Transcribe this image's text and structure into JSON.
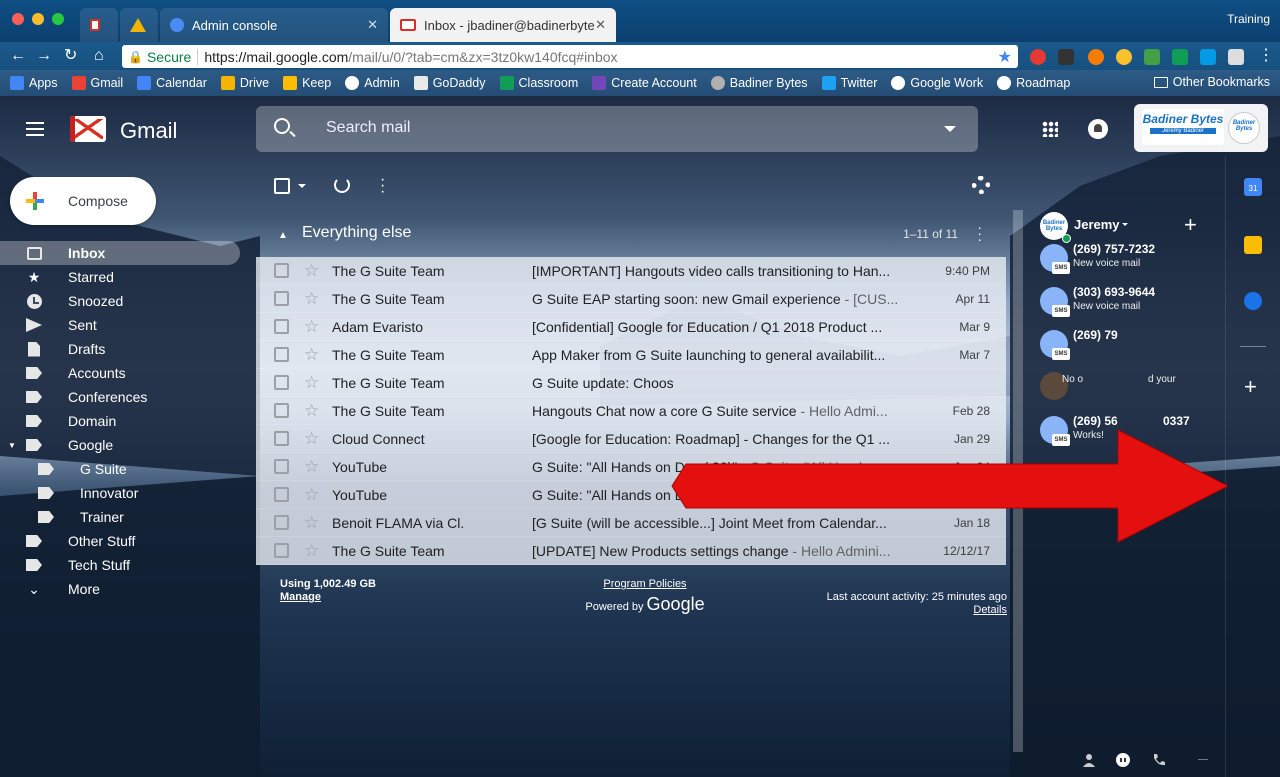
{
  "browser": {
    "tabs": [
      {
        "title": "",
        "icon": "gmail-favicon",
        "active": false
      },
      {
        "title": "",
        "icon": "drive-favicon",
        "active": false
      },
      {
        "title": "Admin console",
        "icon": "admin-favicon",
        "active": false
      },
      {
        "title": "Inbox - jbadiner@badinerbytes",
        "icon": "gmail-favicon",
        "active": true
      }
    ],
    "profile_label": "Training",
    "omnibox": {
      "secure_label": "Secure",
      "url_host": "https://mail.google.com",
      "url_path": "/mail/u/0/?tab=cm&zx=3tz0kw140fcq#inbox"
    },
    "bookmarks": [
      {
        "label": "Apps",
        "icon": "apps-grid-icon",
        "color": "#4285f4"
      },
      {
        "label": "Gmail",
        "icon": "gmail-icon",
        "color": "#ea4335"
      },
      {
        "label": "Calendar",
        "icon": "calendar-icon",
        "color": "#4285f4"
      },
      {
        "label": "Drive",
        "icon": "drive-icon",
        "color": "#f4b400"
      },
      {
        "label": "Keep",
        "icon": "keep-icon",
        "color": "#fbbc04"
      },
      {
        "label": "Admin",
        "icon": "google-g-icon",
        "color": "#ffffff"
      },
      {
        "label": "GoDaddy",
        "icon": "godaddy-icon",
        "color": "#e8e8e8"
      },
      {
        "label": "Classroom",
        "icon": "classroom-icon",
        "color": "#0f9d58"
      },
      {
        "label": "Create Account",
        "icon": "forms-icon",
        "color": "#7248b9"
      },
      {
        "label": "Badiner Bytes",
        "icon": "avatar-icon",
        "color": "#b0b0b0"
      },
      {
        "label": "Twitter",
        "icon": "twitter-icon",
        "color": "#1da1f2"
      },
      {
        "label": "Google Work",
        "icon": "google-g-icon",
        "color": "#ffffff"
      },
      {
        "label": "Roadmap",
        "icon": "google-g-icon",
        "color": "#ffffff"
      }
    ],
    "other_bookmarks": "Other Bookmarks"
  },
  "header": {
    "app_name": "Gmail",
    "search_placeholder": "Search mail",
    "account_brand": "Badiner Bytes",
    "account_brand_sub": "Jeremy Badiner"
  },
  "compose_label": "Compose",
  "nav": [
    {
      "label": "Inbox",
      "icon": "inbox-icon",
      "active": true
    },
    {
      "label": "Starred",
      "icon": "star-icon"
    },
    {
      "label": "Snoozed",
      "icon": "clock-icon"
    },
    {
      "label": "Sent",
      "icon": "send-icon"
    },
    {
      "label": "Drafts",
      "icon": "draft-icon"
    },
    {
      "label": "Accounts",
      "icon": "label-icon"
    },
    {
      "label": "Conferences",
      "icon": "label-icon"
    },
    {
      "label": "Domain",
      "icon": "label-icon"
    },
    {
      "label": "Google",
      "icon": "label-icon",
      "expanded": true
    },
    {
      "label": "G Suite",
      "icon": "label-icon",
      "sub": true
    },
    {
      "label": "Innovator",
      "icon": "label-icon",
      "sub": true
    },
    {
      "label": "Trainer",
      "icon": "label-icon",
      "sub": true
    },
    {
      "label": "Other Stuff",
      "icon": "label-icon"
    },
    {
      "label": "Tech Stuff",
      "icon": "label-icon"
    },
    {
      "label": "More",
      "icon": "chevron-down-icon"
    }
  ],
  "section": {
    "title": "Everything else",
    "count": "1–11 of 11"
  },
  "emails": [
    {
      "sender": "The G Suite Team",
      "subject": "[IMPORTANT] Hangouts video calls transitioning to Han...",
      "snippet": "",
      "date": "9:40 PM"
    },
    {
      "sender": "The G Suite Team",
      "subject": "G Suite EAP starting soon: new Gmail experience",
      "snippet": " - [CUS...",
      "date": "Apr 11"
    },
    {
      "sender": "Adam Evaristo",
      "subject": "[Confidential] Google for Education / Q1 2018 Product ...",
      "snippet": "",
      "date": "Mar 9"
    },
    {
      "sender": "The G Suite Team",
      "subject": "App Maker from G Suite launching to general availabilit...",
      "snippet": "",
      "date": "Mar 7"
    },
    {
      "sender": "The G Suite Team",
      "subject": "G Suite update: Choos",
      "snippet": "",
      "date": ""
    },
    {
      "sender": "The G Suite Team",
      "subject": "Hangouts Chat now a core G Suite service",
      "snippet": " - Hello Admi...",
      "date": "Feb 28"
    },
    {
      "sender": "Cloud Connect",
      "subject": "[Google for Education: Roadmap] - Changes for the Q1 ...",
      "snippet": "",
      "date": "Jan 29"
    },
    {
      "sender": "YouTube",
      "subject": "G Suite: \"All Hands on Doc (:30)\"",
      "snippet": " - G Suite: \"All Hands on...",
      "date": "Jan 24"
    },
    {
      "sender": "YouTube",
      "subject": "G Suite: \"All Hands on Doc (:30)\"",
      "snippet": " - G Suite: \"All Hands on...",
      "date": "Jan 19"
    },
    {
      "sender": "Benoit FLAMA via Cl.",
      "subject": "[G Suite (will be accessible...] Joint Meet from Calendar...",
      "snippet": "",
      "date": "Jan 18"
    },
    {
      "sender": "The G Suite Team",
      "subject": "[UPDATE] New Products settings change",
      "snippet": " - Hello Admini...",
      "date": "12/12/17"
    }
  ],
  "footer": {
    "storage": "Using 1,002.49 GB",
    "manage": "Manage",
    "program_policies": "Program Policies",
    "powered_by": "Powered by",
    "google": "Google",
    "last_activity": "Last account activity: 25 minutes ago",
    "details": "Details"
  },
  "hangouts": {
    "me": "Jeremy",
    "me_avatar_text": "Badiner Bytes",
    "contacts": [
      {
        "name": "(269) 757-7232",
        "message": "New voice mail",
        "badge": "SMS"
      },
      {
        "name": "(303) 693-9644",
        "message": "New voice mail",
        "badge": "SMS"
      },
      {
        "name": "(269) 79",
        "message": "",
        "badge": "SMS"
      },
      {
        "name": "",
        "message": "No o",
        "message2": "d your",
        "badge": ""
      },
      {
        "name": "(269) 56",
        "name2": "0337",
        "message": "Works!",
        "badge": "SMS"
      }
    ]
  },
  "side_panel": {
    "calendar_day": "31"
  },
  "colors": {
    "arrow": "#e40f0f",
    "accent": "#1a73e8"
  }
}
